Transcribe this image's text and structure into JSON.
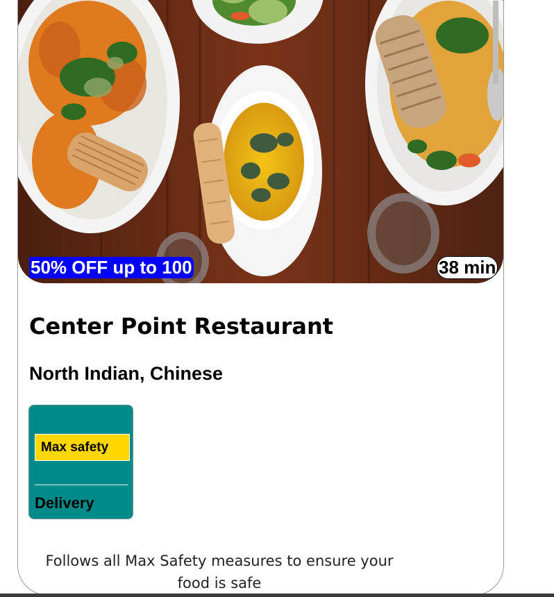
{
  "card": {
    "offer_badge": "50% OFF up to 100",
    "delivery_time": "38 min",
    "restaurant_name": "Center Point Restaurant",
    "cuisines": "North Indian, Chinese",
    "safety": {
      "tag": "Max safety",
      "label": "Delivery",
      "note": "Follows all Max Safety measures to ensure your food is safe"
    },
    "image_icon": "food-photo-icon"
  },
  "colors": {
    "offer_bg": "#0000ff",
    "safety_bg": "#008b8b",
    "safety_tag_bg": "#ffd700",
    "time_bg": "#ffffff"
  }
}
